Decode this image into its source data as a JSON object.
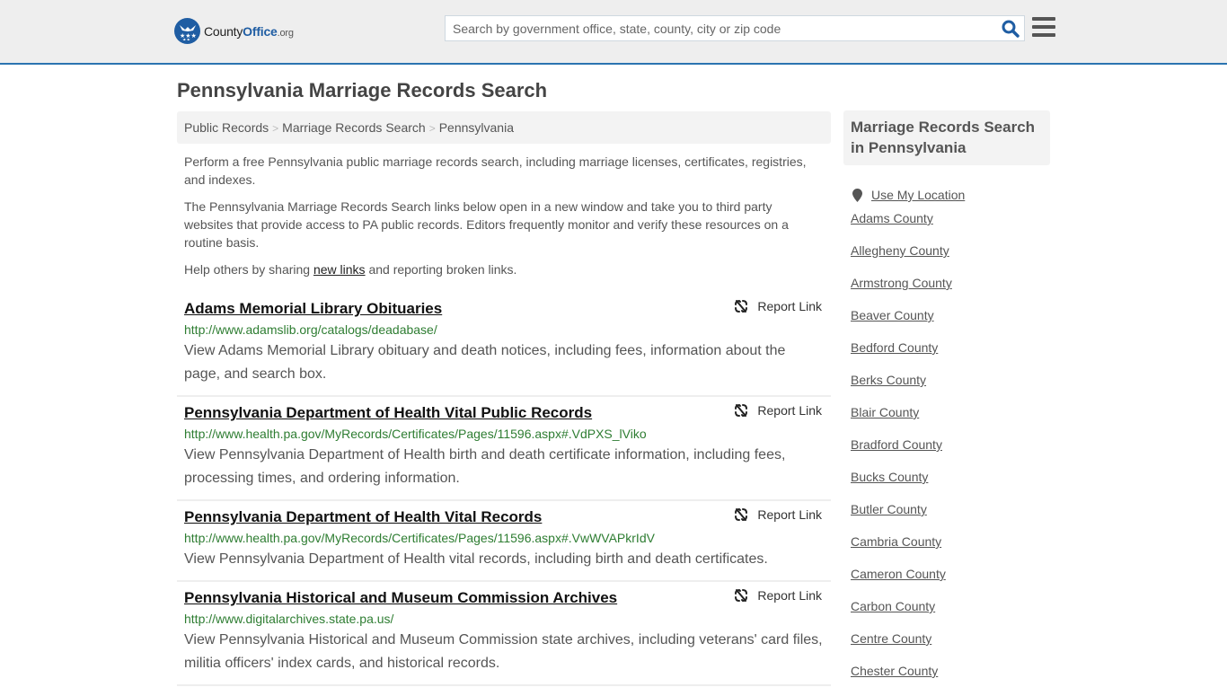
{
  "header": {
    "logo": {
      "brand_main": "County",
      "brand_accent": "Office",
      "brand_tld": ".org"
    },
    "search": {
      "placeholder": "Search by government office, state, county, city or zip code",
      "value": ""
    },
    "icons": {
      "search": "search-icon",
      "menu": "hamburger-menu-icon"
    }
  },
  "page": {
    "title": "Pennsylvania Marriage Records Search"
  },
  "breadcrumb": [
    {
      "label": "Public Records"
    },
    {
      "label": "Marriage Records Search"
    },
    {
      "label": "Pennsylvania"
    }
  ],
  "breadcrumb_separator": ">",
  "intro": {
    "p1": "Perform a free Pennsylvania public marriage records search, including marriage licenses, certificates, registries, and indexes.",
    "p2": "The Pennsylvania Marriage Records Search links below open in a new window and take you to third party websites that provide access to PA public records. Editors frequently monitor and verify these resources on a routine basis.",
    "p3_before": "Help others by sharing ",
    "p3_link": "new links",
    "p3_after": " and reporting broken links."
  },
  "report_label": "Report Link",
  "results": [
    {
      "title": "Adams Memorial Library Obituaries",
      "url": "http://www.adamslib.org/catalogs/deadabase/",
      "description": "View Adams Memorial Library obituary and death notices, including fees, information about the page, and search box."
    },
    {
      "title": "Pennsylvania Department of Health Vital Public Records",
      "url": "http://www.health.pa.gov/MyRecords/Certificates/Pages/11596.aspx#.VdPXS_lViko",
      "description": "View Pennsylvania Department of Health birth and death certificate information, including fees, processing times, and ordering information."
    },
    {
      "title": "Pennsylvania Department of Health Vital Records",
      "url": "http://www.health.pa.gov/MyRecords/Certificates/Pages/11596.aspx#.VwWVAPkrIdV",
      "description": "View Pennsylvania Department of Health vital records, including birth and death certificates."
    },
    {
      "title": "Pennsylvania Historical and Museum Commission Archives",
      "url": "http://www.digitalarchives.state.pa.us/",
      "description": "View Pennsylvania Historical and Museum Commission state archives, including veterans' card files, militia officers' index cards, and historical records."
    }
  ],
  "sidebar": {
    "title": "Marriage Records Search in Pennsylvania",
    "use_location": "Use My Location",
    "counties": [
      "Adams County",
      "Allegheny County",
      "Armstrong County",
      "Beaver County",
      "Bedford County",
      "Berks County",
      "Blair County",
      "Bradford County",
      "Bucks County",
      "Butler County",
      "Cambria County",
      "Cameron County",
      "Carbon County",
      "Centre County",
      "Chester County"
    ]
  },
  "colors": {
    "accent": "#2b74b0",
    "brand": "#1f5da3",
    "url_green": "#2e7d32",
    "header_bg": "#eeeeee"
  }
}
